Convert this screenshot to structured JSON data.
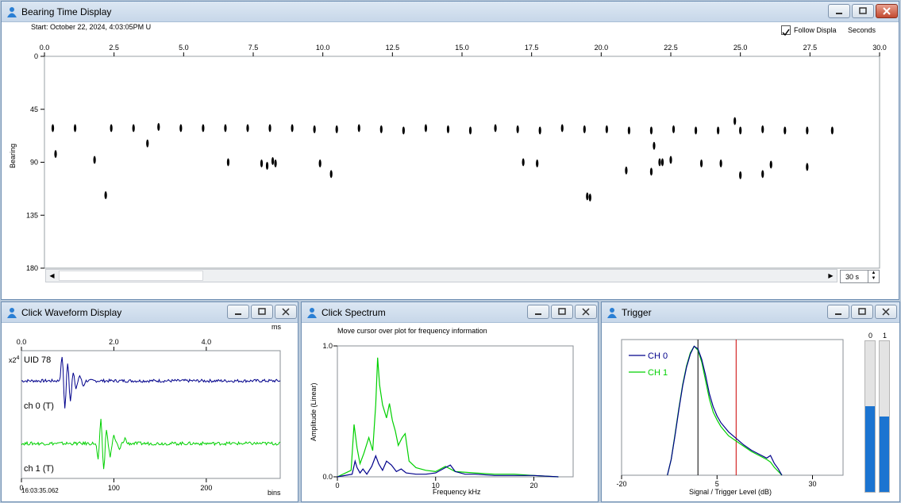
{
  "bearing_window": {
    "title": "Bearing Time Display",
    "start_label": "Start: October 22, 2024, 4:03:05PM U",
    "follow_label": "Follow Displa",
    "seconds_label": "Seconds",
    "follow_checked": true,
    "span_value": "30 s",
    "y_axis_label": "Bearing"
  },
  "waveform_window": {
    "title": "Click Waveform Display",
    "uid_label": "UID 78",
    "ch0_label": "ch 0 (T)",
    "ch1_label": "ch 1 (T)",
    "top_unit": "ms",
    "bottom_unit": "bins",
    "time_label": "16:03:35.062",
    "scale_label": "x2",
    "scale_exp": "4"
  },
  "spectrum_window": {
    "title": "Click Spectrum",
    "hint": "Move cursor over plot for frequency information",
    "x_label": "Frequency kHz",
    "y_label": "Amplitude (Linear)"
  },
  "trigger_window": {
    "title": "Trigger",
    "x_label": "Signal / Trigger Level (dB)",
    "bar_labels": [
      "0",
      "1"
    ],
    "bar_levels": [
      0.57,
      0.5
    ]
  },
  "colors": {
    "ch0": "#00008b",
    "ch1": "#00d000",
    "threshold": "#cc0000",
    "level_bar": "#1b74d1"
  },
  "chart_data": [
    {
      "type": "scatter",
      "name": "bearing-time",
      "xlim": [
        0,
        30
      ],
      "ylim": [
        0,
        180
      ],
      "x_ticks": [
        "0.0",
        "2.5",
        "5.0",
        "7.5",
        "10.0",
        "12.5",
        "15.0",
        "17.5",
        "20.0",
        "22.5",
        "25.0",
        "27.5",
        "30.0"
      ],
      "y_ticks": [
        "0",
        "45",
        "90",
        "135",
        "180"
      ],
      "points": [
        [
          0.3,
          61
        ],
        [
          1.1,
          61
        ],
        [
          2.4,
          61
        ],
        [
          3.2,
          61
        ],
        [
          4.1,
          60
        ],
        [
          4.9,
          61
        ],
        [
          5.7,
          61
        ],
        [
          6.5,
          61
        ],
        [
          7.3,
          61
        ],
        [
          8.1,
          61
        ],
        [
          8.9,
          61
        ],
        [
          9.7,
          62
        ],
        [
          10.5,
          62
        ],
        [
          11.3,
          61
        ],
        [
          12.1,
          62
        ],
        [
          12.9,
          63
        ],
        [
          13.7,
          61
        ],
        [
          14.5,
          62
        ],
        [
          15.3,
          63
        ],
        [
          16.2,
          61
        ],
        [
          17.0,
          62
        ],
        [
          17.8,
          63
        ],
        [
          18.6,
          61
        ],
        [
          19.4,
          62
        ],
        [
          20.2,
          62
        ],
        [
          21.0,
          63
        ],
        [
          21.8,
          63
        ],
        [
          22.6,
          62
        ],
        [
          23.4,
          63
        ],
        [
          24.2,
          63
        ],
        [
          25.0,
          63
        ],
        [
          25.8,
          62
        ],
        [
          26.6,
          63
        ],
        [
          27.4,
          63
        ],
        [
          28.3,
          63
        ],
        [
          24.8,
          55
        ],
        [
          0.4,
          83
        ],
        [
          1.8,
          88
        ],
        [
          2.2,
          118
        ],
        [
          3.7,
          74
        ],
        [
          6.6,
          90
        ],
        [
          7.8,
          91
        ],
        [
          8.0,
          93
        ],
        [
          8.2,
          89
        ],
        [
          8.3,
          91
        ],
        [
          9.9,
          91
        ],
        [
          10.3,
          100
        ],
        [
          17.2,
          90
        ],
        [
          17.7,
          91
        ],
        [
          19.5,
          119
        ],
        [
          19.6,
          120
        ],
        [
          20.9,
          97
        ],
        [
          21.8,
          98
        ],
        [
          21.9,
          76
        ],
        [
          22.1,
          90
        ],
        [
          22.2,
          90
        ],
        [
          22.5,
          88
        ],
        [
          23.6,
          91
        ],
        [
          24.3,
          91
        ],
        [
          25.0,
          101
        ],
        [
          25.8,
          100
        ],
        [
          26.1,
          92
        ],
        [
          27.4,
          94
        ]
      ]
    },
    {
      "type": "line",
      "name": "click-waveform",
      "x_ticks_top": [
        "0.0",
        "2.0",
        "4.0"
      ],
      "x_ticks_bottom": [
        "0",
        "100",
        "200"
      ],
      "top_xlim": [
        0,
        5.6
      ],
      "xlim": [
        0,
        280
      ],
      "series": [
        {
          "channel": "ch0",
          "color": "#00008b",
          "events": [
            [
              44,
              1.0
            ],
            [
              47,
              -1.1
            ],
            [
              50,
              0.7
            ],
            [
              53,
              -0.8
            ],
            [
              56,
              0.4
            ],
            [
              59,
              -0.35
            ],
            [
              63,
              0.2
            ],
            [
              67,
              -0.2
            ]
          ]
        },
        {
          "channel": "ch1",
          "color": "#00d000",
          "events": [
            [
              83,
              -0.6
            ],
            [
              86,
              0.9
            ],
            [
              89,
              -1.0
            ],
            [
              92,
              0.5
            ],
            [
              96,
              -0.5
            ],
            [
              100,
              0.3
            ],
            [
              106,
              -0.25
            ],
            [
              112,
              0.2
            ]
          ]
        }
      ]
    },
    {
      "type": "line",
      "name": "click-spectrum",
      "xlim": [
        0,
        24
      ],
      "ylim": [
        0,
        1
      ],
      "x_ticks": [
        "0",
        "10",
        "20"
      ],
      "y_ticks": [
        "0.0",
        "1.0"
      ],
      "series": [
        {
          "channel": "ch0",
          "color": "#00008b",
          "x": [
            0,
            1.5,
            1.8,
            2.0,
            2.3,
            2.6,
            3.0,
            3.5,
            3.9,
            4.2,
            4.6,
            5.0,
            5.5,
            6.0,
            6.5,
            7.0,
            8,
            9,
            10,
            11,
            11.5,
            12,
            13,
            14,
            16,
            18,
            20,
            22.5
          ],
          "y": [
            0,
            0.02,
            0.12,
            0.07,
            0.03,
            0.06,
            0.02,
            0.08,
            0.16,
            0.1,
            0.05,
            0.12,
            0.09,
            0.04,
            0.06,
            0.03,
            0.02,
            0.02,
            0.03,
            0.07,
            0.09,
            0.04,
            0.02,
            0.02,
            0.01,
            0.01,
            0.01,
            0.0
          ]
        },
        {
          "channel": "ch1",
          "color": "#00d000",
          "x": [
            0,
            1.4,
            1.7,
            2.0,
            2.3,
            2.7,
            3.2,
            3.6,
            3.9,
            4.1,
            4.3,
            4.6,
            5.0,
            5.3,
            5.6,
            5.9,
            6.2,
            6.6,
            6.9,
            7.3,
            8,
            9,
            10,
            11,
            12,
            14,
            16,
            18,
            20,
            22.5
          ],
          "y": [
            0,
            0.05,
            0.4,
            0.22,
            0.1,
            0.18,
            0.3,
            0.2,
            0.55,
            0.91,
            0.7,
            0.55,
            0.45,
            0.56,
            0.43,
            0.35,
            0.24,
            0.3,
            0.33,
            0.12,
            0.07,
            0.05,
            0.04,
            0.08,
            0.04,
            0.03,
            0.02,
            0.02,
            0.01,
            0.0
          ]
        }
      ]
    },
    {
      "type": "line",
      "name": "trigger",
      "xlim": [
        -20,
        38
      ],
      "x_ticks": [
        "-20",
        "5",
        "30"
      ],
      "trigger_line_x": 0,
      "threshold_line_x": 10,
      "series": [
        {
          "name": "CH 0",
          "color": "#00008b",
          "x": [
            -8,
            -7,
            -6,
            -5,
            -4,
            -3,
            -2,
            -1,
            0,
            1,
            2,
            3,
            4,
            5,
            6,
            8,
            10,
            12,
            14,
            16,
            18,
            19,
            20,
            21,
            22
          ],
          "y": [
            0,
            0.12,
            0.3,
            0.5,
            0.68,
            0.82,
            0.92,
            0.98,
            0.96,
            0.88,
            0.76,
            0.62,
            0.52,
            0.45,
            0.4,
            0.33,
            0.28,
            0.23,
            0.19,
            0.16,
            0.13,
            0.15,
            0.09,
            0.05,
            0.0
          ]
        },
        {
          "name": "CH 1",
          "color": "#00d000",
          "x": [
            -8,
            -7,
            -6,
            -5,
            -4,
            -3,
            -2,
            -1,
            0,
            1,
            2,
            3,
            4,
            5,
            6,
            8,
            10,
            12,
            14,
            16,
            18,
            19,
            20,
            21,
            22
          ],
          "y": [
            0,
            0.12,
            0.31,
            0.51,
            0.69,
            0.83,
            0.93,
            0.98,
            0.95,
            0.86,
            0.72,
            0.58,
            0.48,
            0.42,
            0.37,
            0.3,
            0.26,
            0.22,
            0.18,
            0.15,
            0.12,
            0.1,
            0.06,
            0.03,
            0.0
          ]
        }
      ]
    }
  ]
}
